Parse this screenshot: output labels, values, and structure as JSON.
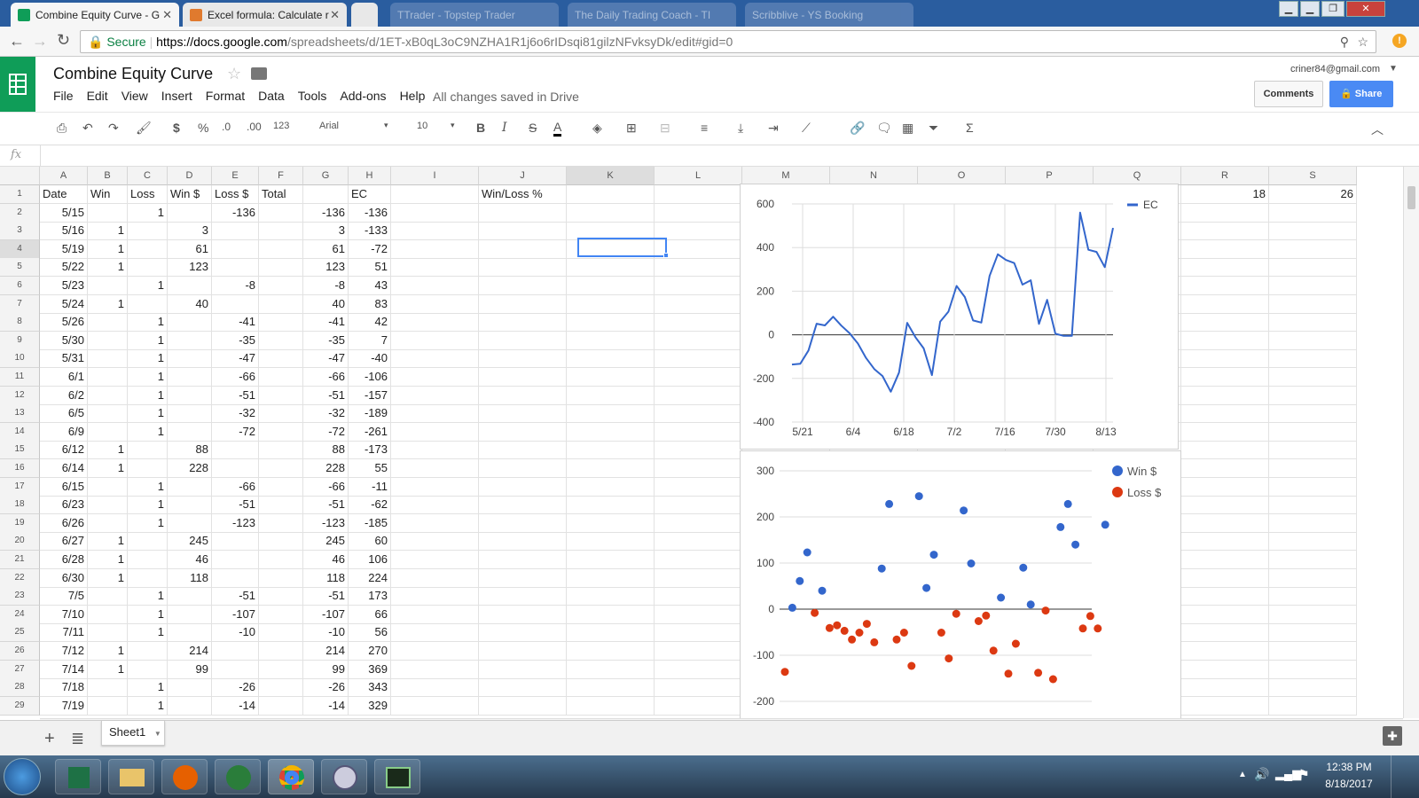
{
  "browser": {
    "tabs": [
      {
        "title": "Combine Equity Curve - G",
        "active": true
      },
      {
        "title": "Excel formula: Calculate r",
        "active": false
      },
      {
        "title": "",
        "active": false
      }
    ],
    "ghost_tabs": [
      "TTrader - Topstep Trader",
      "The Daily Trading Coach - TI",
      "Scribblive - YS Booking"
    ],
    "secure_label": "Secure",
    "url_base": "https://docs.google.com",
    "url_path": "/spreadsheets/d/1ET-xB0qL3oC9NZHA1R1j6o6rIDsqi81gilzNFvksyDk/edit#gid=0"
  },
  "app": {
    "doc_title": "Combine Equity Curve",
    "menus": [
      "File",
      "Edit",
      "View",
      "Insert",
      "Format",
      "Data",
      "Tools",
      "Add-ons",
      "Help"
    ],
    "saved_status": "All changes saved in Drive",
    "user_email": "criner84@gmail.com",
    "comments_label": "Comments",
    "share_label": "Share"
  },
  "toolbar": {
    "currency": "$",
    "percent": "%",
    "dec_less": ".0",
    "dec_more": ".00",
    "more_formats": "123",
    "font": "Arial",
    "font_size": "10",
    "bold": "B",
    "italic": "I",
    "strike": "S",
    "text_color": "A",
    "sum": "Σ"
  },
  "formula_bar": {
    "fx": "fx",
    "content": ""
  },
  "grid": {
    "columns": [
      "A",
      "B",
      "C",
      "D",
      "E",
      "F",
      "G",
      "H",
      "I",
      "J",
      "K",
      "L",
      "M",
      "N",
      "O",
      "P",
      "Q",
      "R",
      "S"
    ],
    "header_row": {
      "A": "Date",
      "B": "Win",
      "C": "Loss",
      "D": "Win $",
      "E": "Loss $",
      "F": "Total",
      "G": "",
      "H": "EC",
      "J": "Win/Loss %",
      "R": "18",
      "S": "26"
    },
    "rows": [
      [
        "5/15",
        "",
        "1",
        "",
        "-136",
        "",
        "-136",
        "-136"
      ],
      [
        "5/16",
        "1",
        "",
        "3",
        "",
        "",
        "3",
        "-133"
      ],
      [
        "5/19",
        "1",
        "",
        "61",
        "",
        "",
        "61",
        "-72"
      ],
      [
        "5/22",
        "1",
        "",
        "123",
        "",
        "",
        "123",
        "51"
      ],
      [
        "5/23",
        "",
        "1",
        "",
        "-8",
        "",
        "-8",
        "43"
      ],
      [
        "5/24",
        "1",
        "",
        "40",
        "",
        "",
        "40",
        "83"
      ],
      [
        "5/26",
        "",
        "1",
        "",
        "-41",
        "",
        "-41",
        "42"
      ],
      [
        "5/30",
        "",
        "1",
        "",
        "-35",
        "",
        "-35",
        "7"
      ],
      [
        "5/31",
        "",
        "1",
        "",
        "-47",
        "",
        "-47",
        "-40"
      ],
      [
        "6/1",
        "",
        "1",
        "",
        "-66",
        "",
        "-66",
        "-106"
      ],
      [
        "6/2",
        "",
        "1",
        "",
        "-51",
        "",
        "-51",
        "-157"
      ],
      [
        "6/5",
        "",
        "1",
        "",
        "-32",
        "",
        "-32",
        "-189"
      ],
      [
        "6/9",
        "",
        "1",
        "",
        "-72",
        "",
        "-72",
        "-261"
      ],
      [
        "6/12",
        "1",
        "",
        "88",
        "",
        "",
        "88",
        "-173"
      ],
      [
        "6/14",
        "1",
        "",
        "228",
        "",
        "",
        "228",
        "55"
      ],
      [
        "6/15",
        "",
        "1",
        "",
        "-66",
        "",
        "-66",
        "-11"
      ],
      [
        "6/23",
        "",
        "1",
        "",
        "-51",
        "",
        "-51",
        "-62"
      ],
      [
        "6/26",
        "",
        "1",
        "",
        "-123",
        "",
        "-123",
        "-185"
      ],
      [
        "6/27",
        "1",
        "",
        "245",
        "",
        "",
        "245",
        "60"
      ],
      [
        "6/28",
        "1",
        "",
        "46",
        "",
        "",
        "46",
        "106"
      ],
      [
        "6/30",
        "1",
        "",
        "118",
        "",
        "",
        "118",
        "224"
      ],
      [
        "7/5",
        "",
        "1",
        "",
        "-51",
        "",
        "-51",
        "173"
      ],
      [
        "7/10",
        "",
        "1",
        "",
        "-107",
        "",
        "-107",
        "66"
      ],
      [
        "7/11",
        "",
        "1",
        "",
        "-10",
        "",
        "-10",
        "56"
      ],
      [
        "7/12",
        "1",
        "",
        "214",
        "",
        "",
        "214",
        "270"
      ],
      [
        "7/14",
        "1",
        "",
        "99",
        "",
        "",
        "99",
        "369"
      ],
      [
        "7/18",
        "",
        "1",
        "",
        "-26",
        "",
        "-26",
        "343"
      ],
      [
        "7/19",
        "",
        "1",
        "",
        "-14",
        "",
        "-14",
        "329"
      ]
    ]
  },
  "sheet_tab": "Sheet1",
  "taskbar": {
    "time": "12:38 PM",
    "date": "8/18/2017"
  },
  "chart_data": [
    {
      "type": "line",
      "legend": [
        "EC"
      ],
      "legend_position": "top-right",
      "ylim": [
        -400,
        600
      ],
      "yticks": [
        "600",
        "400",
        "200",
        "0",
        "-200",
        "-400"
      ],
      "xticks": [
        "5/21",
        "6/4",
        "6/18",
        "7/2",
        "7/16",
        "7/30",
        "8/13"
      ],
      "series": [
        {
          "name": "EC",
          "color": "#3366cc",
          "x": [
            "5/15",
            "5/16",
            "5/19",
            "5/22",
            "5/23",
            "5/24",
            "5/26",
            "5/30",
            "5/31",
            "6/1",
            "6/2",
            "6/5",
            "6/9",
            "6/12",
            "6/14",
            "6/15",
            "6/23",
            "6/26",
            "6/27",
            "6/28",
            "6/30",
            "7/5",
            "7/10",
            "7/11",
            "7/12",
            "7/14",
            "7/18",
            "7/19",
            "7/21",
            "7/24",
            "7/28",
            "7/31",
            "8/1",
            "8/3",
            "8/7",
            "8/8",
            "8/10",
            "8/11",
            "8/14",
            "8/15"
          ],
          "values": [
            -136,
            -133,
            -72,
            51,
            43,
            83,
            42,
            7,
            -40,
            -106,
            -157,
            -189,
            -261,
            -173,
            55,
            -11,
            -62,
            -185,
            60,
            106,
            224,
            173,
            66,
            56,
            270,
            369,
            343,
            329,
            230,
            250,
            50,
            160,
            5,
            -5,
            -5,
            560,
            390,
            380,
            310,
            490
          ]
        }
      ]
    },
    {
      "type": "scatter",
      "legend": [
        "Win $",
        "Loss $"
      ],
      "legend_position": "top-right",
      "ylim": [
        -200,
        300
      ],
      "yticks": [
        "300",
        "200",
        "100",
        "0",
        "-100",
        "-200"
      ],
      "series": [
        {
          "name": "Win $",
          "color": "#3366cc",
          "points": [
            [
              1,
              3
            ],
            [
              2,
              61
            ],
            [
              3,
              123
            ],
            [
              5,
              40
            ],
            [
              13,
              88
            ],
            [
              14,
              228
            ],
            [
              18,
              245
            ],
            [
              19,
              46
            ],
            [
              20,
              118
            ],
            [
              24,
              214
            ],
            [
              25,
              99
            ],
            [
              29,
              25
            ],
            [
              32,
              90
            ],
            [
              33,
              10
            ],
            [
              37,
              178
            ],
            [
              38,
              228
            ],
            [
              39,
              140
            ],
            [
              43,
              183
            ]
          ]
        },
        {
          "name": "Loss $",
          "color": "#dc3912",
          "points": [
            [
              0,
              -136
            ],
            [
              4,
              -8
            ],
            [
              6,
              -41
            ],
            [
              7,
              -35
            ],
            [
              8,
              -47
            ],
            [
              9,
              -66
            ],
            [
              10,
              -51
            ],
            [
              11,
              -32
            ],
            [
              12,
              -72
            ],
            [
              15,
              -66
            ],
            [
              16,
              -51
            ],
            [
              17,
              -123
            ],
            [
              21,
              -51
            ],
            [
              22,
              -107
            ],
            [
              23,
              -10
            ],
            [
              26,
              -26
            ],
            [
              27,
              -14
            ],
            [
              28,
              -90
            ],
            [
              30,
              -140
            ],
            [
              31,
              -75
            ],
            [
              34,
              -138
            ],
            [
              35,
              -3
            ],
            [
              36,
              -152
            ],
            [
              40,
              -42
            ],
            [
              41,
              -15
            ],
            [
              42,
              -42
            ]
          ]
        }
      ]
    }
  ]
}
